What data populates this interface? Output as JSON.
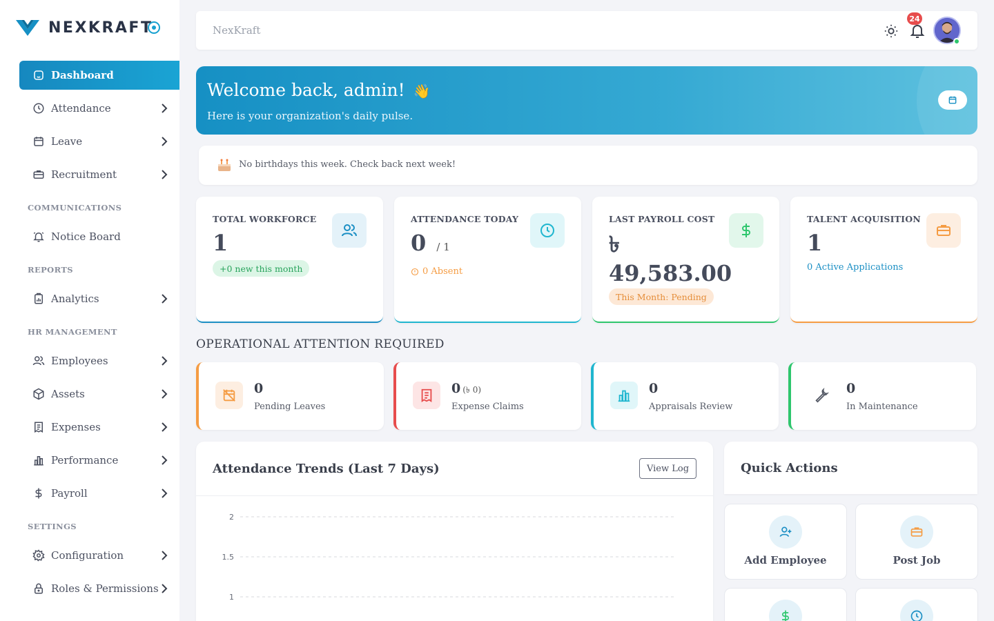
{
  "app": {
    "name": "NEXKRAFT"
  },
  "colors": {
    "accent": "#16a0cf",
    "green": "#2ec66d",
    "orange": "#f59c43",
    "red": "#e74c4c",
    "cyan": "#1fb6cf"
  },
  "sidebar": {
    "items": {
      "dashboard": {
        "label": "Dashboard",
        "icon": "home-icon"
      },
      "attendance": {
        "label": "Attendance",
        "icon": "clock-icon"
      },
      "leave": {
        "label": "Leave",
        "icon": "calendar-icon"
      },
      "recruitment": {
        "label": "Recruitment",
        "icon": "briefcase-icon"
      },
      "notice_board": {
        "label": "Notice Board",
        "icon": "bell-icon"
      },
      "analytics": {
        "label": "Analytics",
        "icon": "clipboard-chart-icon"
      },
      "employees": {
        "label": "Employees",
        "icon": "users-icon"
      },
      "assets": {
        "label": "Assets",
        "icon": "box-icon"
      },
      "expenses": {
        "label": "Expenses",
        "icon": "receipt-icon"
      },
      "performance": {
        "label": "Performance",
        "icon": "bar-chart-icon"
      },
      "payroll": {
        "label": "Payroll",
        "icon": "dollar-icon"
      },
      "configuration": {
        "label": "Configuration",
        "icon": "gear-icon"
      },
      "roles": {
        "label": "Roles & Permissions",
        "icon": "lock-icon"
      }
    },
    "sections": {
      "communications": "COMMUNICATIONS",
      "reports": "REPORTS",
      "hr_management": "HR MANAGEMENT",
      "settings": "SETTINGS"
    }
  },
  "topbar": {
    "breadcrumb": "NexKraft",
    "notification_count": "24"
  },
  "welcome": {
    "title": "Welcome back, admin!",
    "emoji": "👋",
    "subtitle": "Here is your organization's daily pulse."
  },
  "birthday": {
    "message": "No birthdays this week. Check back next week!"
  },
  "stats": {
    "workforce": {
      "label": "TOTAL WORKFORCE",
      "value": "1",
      "pill": "+0 new this month"
    },
    "attendance": {
      "label": "ATTENDANCE TODAY",
      "value": "0",
      "total": "/ 1",
      "absent": "0 Absent"
    },
    "payroll": {
      "label": "LAST PAYROLL COST",
      "currency": "৳",
      "value": "49,583.00",
      "pill": "This Month: Pending"
    },
    "talent": {
      "label": "TALENT ACQUISITION",
      "value": "1",
      "link": "0 Active Applications"
    }
  },
  "attention": {
    "title": "OPERATIONAL ATTENTION REQUIRED",
    "leaves": {
      "value": "0",
      "label": "Pending Leaves"
    },
    "claims": {
      "value": "0",
      "sub": "(৳ 0)",
      "label": "Expense Claims"
    },
    "appraisals": {
      "value": "0",
      "label": "Appraisals Review"
    },
    "maintenance": {
      "value": "0",
      "label": "In Maintenance"
    }
  },
  "attendance_chart": {
    "title": "Attendance Trends (Last 7 Days)",
    "button": "View Log"
  },
  "chart_data": {
    "type": "line",
    "title": "Attendance Trends (Last 7 Days)",
    "y_ticks": [
      "2",
      "1.5",
      "1"
    ],
    "grid": true
  },
  "quick_actions": {
    "title": "Quick Actions",
    "add_employee": "Add Employee",
    "post_job": "Post Job"
  }
}
